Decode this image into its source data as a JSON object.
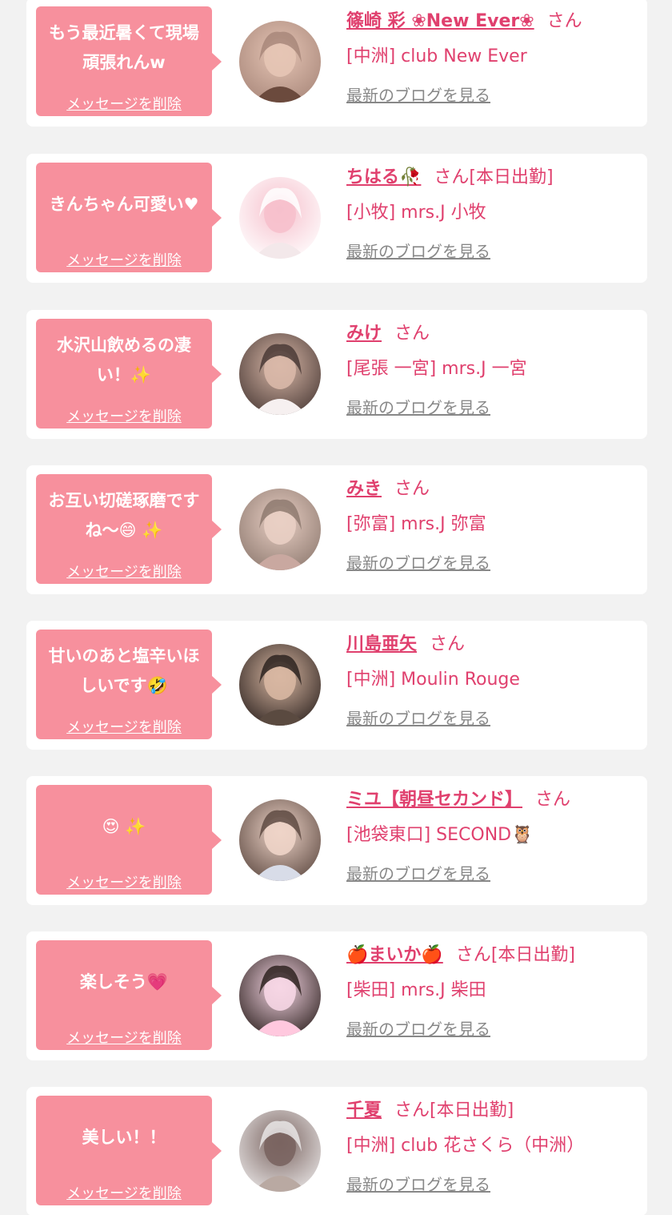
{
  "colors": {
    "page_background": "#f2f2f2",
    "card_background": "#ffffff",
    "bubble_pink": "#f7909d",
    "accent_pink": "#e0406e",
    "link_gray": "#888888"
  },
  "cards": [
    {
      "message": "もう最近暑くて現場頑張れんw",
      "message_emoji": "",
      "delete_label": "メッセージを削除",
      "name": "篠崎 彩 ❀New Ever❀",
      "honorific": "さん",
      "status": "",
      "shop": "[中洲] club New Ever",
      "blog_label": "最新のブログを見る",
      "avatar_icon": "avatar-photo-woman",
      "avatar_colors": [
        "#a8877a",
        "#e6c5b5",
        "#6b4a3d"
      ]
    },
    {
      "message": "きんちゃん可愛い",
      "message_emoji": "♥",
      "delete_label": "メッセージを削除",
      "name": "ちはる🥀",
      "honorific": "さん",
      "status": "[本日出勤]",
      "shop": "[小牧] mrs.J 小牧",
      "blog_label": "最新のブログを見る",
      "avatar_icon": "avatar-my-melody-plush",
      "avatar_colors": [
        "#ffffff",
        "#f6c0cc",
        "#f3e8ea"
      ]
    },
    {
      "message": "水沢山飲めるの凄い！",
      "message_emoji": "✨",
      "delete_label": "メッセージを削除",
      "name": "みけ",
      "honorific": "さん",
      "status": "",
      "shop": "[尾張 一宮] mrs.J 一宮",
      "blog_label": "最新のブログを見る",
      "avatar_icon": "avatar-photo-woman",
      "avatar_colors": [
        "#4a3a36",
        "#d9b8a8",
        "#f6f0f0"
      ]
    },
    {
      "message": "お互い切磋琢磨ですね〜",
      "message_emoji": "😄 ✨",
      "delete_label": "メッセージを削除",
      "name": "みき",
      "honorific": "さん",
      "status": "",
      "shop": "[弥富] mrs.J 弥富",
      "blog_label": "最新のブログを見る",
      "avatar_icon": "avatar-photo-woman",
      "avatar_colors": [
        "#8e7a70",
        "#e9cfc4",
        "#c9a8a0"
      ]
    },
    {
      "message": "甘いのあと塩辛いほしいです",
      "message_emoji": "🤣",
      "delete_label": "メッセージを削除",
      "name": "川島亜矢",
      "honorific": "さん",
      "status": "",
      "shop": "[中洲] Moulin Rouge",
      "blog_label": "最新のブログを見る",
      "avatar_icon": "avatar-photo-woman",
      "avatar_colors": [
        "#2d2320",
        "#d8b7a2",
        "#5a4a40"
      ]
    },
    {
      "message": "",
      "message_emoji": "😍 ✨",
      "delete_label": "メッセージを削除",
      "name": "ミユ【朝昼セカンド】",
      "honorific": "さん",
      "status": "",
      "shop": "[池袋東口] SECOND🦉",
      "blog_label": "最新のブログを見る",
      "avatar_icon": "avatar-photo-woman",
      "avatar_colors": [
        "#5e4a42",
        "#eed4c8",
        "#d8dce8"
      ]
    },
    {
      "message": "楽しそう",
      "message_emoji": "💗",
      "delete_label": "メッセージを削除",
      "name": "🍎まいか🍎",
      "honorific": "さん",
      "status": "[本日出勤]",
      "shop": "[柴田] mrs.J 柴田",
      "blog_label": "最新のブログを見る",
      "avatar_icon": "avatar-photo-woman",
      "avatar_colors": [
        "#2e2220",
        "#f6d6e4",
        "#ffc8de"
      ]
    },
    {
      "message": "美しい！！",
      "message_emoji": "",
      "delete_label": "メッセージを削除",
      "name": "千夏",
      "honorific": "さん",
      "status": "[本日出勤]",
      "shop": "[中洲] club 花さくら（中洲）",
      "blog_label": "最新のブログを見る",
      "avatar_icon": "avatar-photo-woman",
      "avatar_colors": [
        "#e9e6e6",
        "#7a6460",
        "#b9a9a2"
      ]
    }
  ]
}
